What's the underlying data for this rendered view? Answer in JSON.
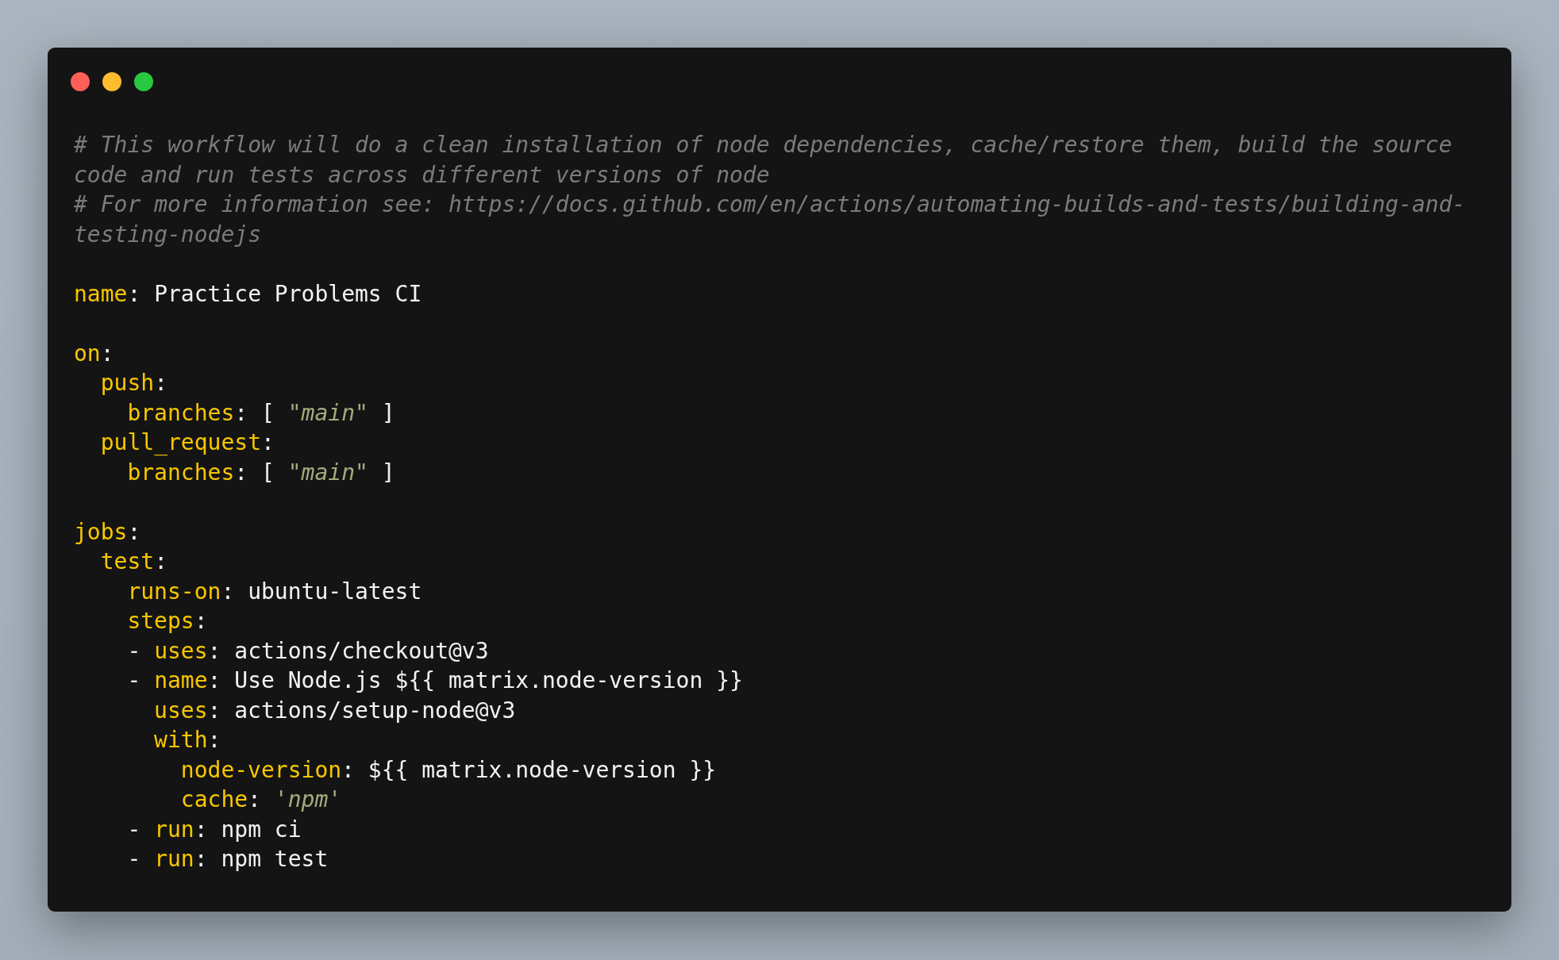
{
  "lines": [
    {
      "kind": "comment",
      "text": "# This workflow will do a clean installation of node dependencies, cache/restore them, build the source code and run tests across different versions of node"
    },
    {
      "kind": "comment",
      "text": "# For more information see: https://docs.github.com/en/actions/automating-builds-and-tests/building-and-testing-nodejs"
    },
    {
      "kind": "blank"
    },
    {
      "kind": "code",
      "tokens": [
        {
          "kind": "key",
          "text": "name"
        },
        {
          "kind": "plain",
          "text": ": Practice Problems CI"
        }
      ]
    },
    {
      "kind": "blank"
    },
    {
      "kind": "code",
      "tokens": [
        {
          "kind": "key",
          "text": "on"
        },
        {
          "kind": "plain",
          "text": ":"
        }
      ],
      "children": [
        {
          "kind": "code",
          "tokens": [
            {
              "kind": "key",
              "text": "push"
            },
            {
              "kind": "plain",
              "text": ":"
            }
          ],
          "children": [
            {
              "kind": "code",
              "tokens": [
                {
                  "kind": "key",
                  "text": "branches"
                },
                {
                  "kind": "plain",
                  "text": ": [ "
                },
                {
                  "kind": "string",
                  "text": "\"main\""
                },
                {
                  "kind": "plain",
                  "text": " ]"
                }
              ]
            }
          ]
        },
        {
          "kind": "code",
          "tokens": [
            {
              "kind": "key",
              "text": "pull_request"
            },
            {
              "kind": "plain",
              "text": ":"
            }
          ],
          "children": [
            {
              "kind": "code",
              "tokens": [
                {
                  "kind": "key",
                  "text": "branches"
                },
                {
                  "kind": "plain",
                  "text": ": [ "
                },
                {
                  "kind": "string",
                  "text": "\"main\""
                },
                {
                  "kind": "plain",
                  "text": " ]"
                }
              ]
            }
          ]
        }
      ]
    },
    {
      "kind": "blank"
    },
    {
      "kind": "code",
      "tokens": [
        {
          "kind": "key",
          "text": "jobs"
        },
        {
          "kind": "plain",
          "text": ":"
        }
      ],
      "children": [
        {
          "kind": "code",
          "tokens": [
            {
              "kind": "key",
              "text": "test"
            },
            {
              "kind": "plain",
              "text": ":"
            }
          ],
          "children": [
            {
              "kind": "code",
              "tokens": [
                {
                  "kind": "key",
                  "text": "runs-on"
                },
                {
                  "kind": "plain",
                  "text": ": ubuntu-latest"
                }
              ]
            },
            {
              "kind": "code",
              "tokens": [
                {
                  "kind": "key",
                  "text": "steps"
                },
                {
                  "kind": "plain",
                  "text": ":"
                }
              ]
            },
            {
              "kind": "code",
              "tokens": [
                {
                  "kind": "plain",
                  "text": "- "
                },
                {
                  "kind": "key",
                  "text": "uses"
                },
                {
                  "kind": "plain",
                  "text": ": actions/checkout@v3"
                }
              ]
            },
            {
              "kind": "code",
              "tokens": [
                {
                  "kind": "plain",
                  "text": "- "
                },
                {
                  "kind": "key",
                  "text": "name"
                },
                {
                  "kind": "plain",
                  "text": ": Use Node.js ${{ matrix.node-version }}"
                }
              ],
              "children": [
                {
                  "kind": "code",
                  "tokens": [
                    {
                      "kind": "key",
                      "text": "uses"
                    },
                    {
                      "kind": "plain",
                      "text": ": actions/setup-node@v3"
                    }
                  ]
                },
                {
                  "kind": "code",
                  "tokens": [
                    {
                      "kind": "key",
                      "text": "with"
                    },
                    {
                      "kind": "plain",
                      "text": ":"
                    }
                  ],
                  "children": [
                    {
                      "kind": "code",
                      "tokens": [
                        {
                          "kind": "key",
                          "text": "node-version"
                        },
                        {
                          "kind": "plain",
                          "text": ": ${{ matrix.node-version }}"
                        }
                      ]
                    },
                    {
                      "kind": "code",
                      "tokens": [
                        {
                          "kind": "key",
                          "text": "cache"
                        },
                        {
                          "kind": "plain",
                          "text": ": "
                        },
                        {
                          "kind": "string",
                          "text": "'npm'"
                        }
                      ]
                    }
                  ]
                }
              ]
            },
            {
              "kind": "code",
              "tokens": [
                {
                  "kind": "plain",
                  "text": "- "
                },
                {
                  "kind": "key",
                  "text": "run"
                },
                {
                  "kind": "plain",
                  "text": ": npm ci"
                }
              ]
            },
            {
              "kind": "code",
              "tokens": [
                {
                  "kind": "plain",
                  "text": "- "
                },
                {
                  "kind": "key",
                  "text": "run"
                },
                {
                  "kind": "plain",
                  "text": ": npm test"
                }
              ]
            }
          ]
        }
      ]
    }
  ]
}
